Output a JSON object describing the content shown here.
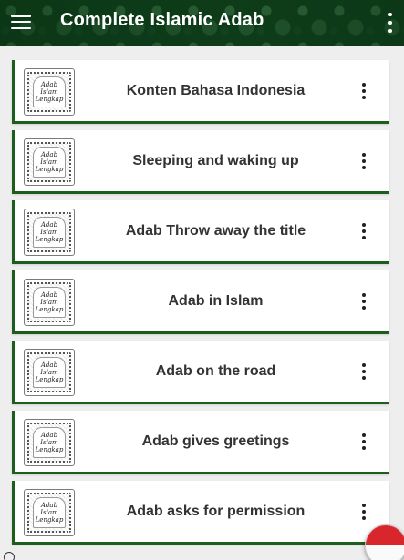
{
  "appbar": {
    "title": "Complete Islamic Adab",
    "menu_icon": "hamburger-menu-icon",
    "overflow_icon": "more-vertical-icon"
  },
  "thumbnail_text": [
    "Adab",
    "Islam",
    "Lengkap"
  ],
  "items": [
    {
      "label": "Konten Bahasa Indonesia"
    },
    {
      "label": "Sleeping and waking up"
    },
    {
      "label": "Adab Throw away the title"
    },
    {
      "label": "Adab in Islam"
    },
    {
      "label": "Adab on the road"
    },
    {
      "label": "Adab gives greetings"
    },
    {
      "label": "Adab asks for permission"
    }
  ],
  "colors": {
    "appbar_green": "#0f3f1a",
    "card_accent": "#1d5e1f",
    "flag_red": "#d9262c",
    "flag_white": "#fafafa"
  },
  "fab": {
    "icon": "indonesia-flag-icon"
  }
}
